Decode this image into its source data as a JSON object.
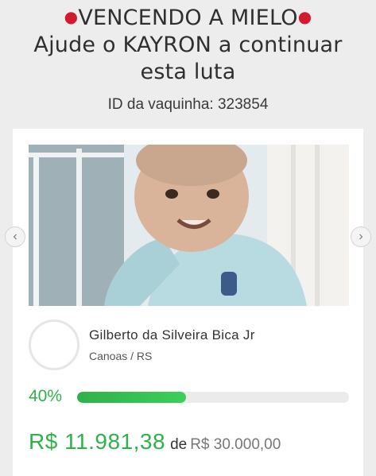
{
  "header": {
    "glove_icon": "boxing-glove-icon",
    "title_line1": "VENCENDO A MIELO",
    "title_line2": "Ajude o KAYRON a continuar",
    "title_line3": "esta luta",
    "campaign_id": "ID da vaquinha: 323854"
  },
  "gallery": {
    "prev_icon": "‹",
    "next_icon": "›"
  },
  "creator": {
    "name": "Gilberto da Silveira Bica Jr",
    "location": "Canoas / RS"
  },
  "progress": {
    "percent_label": "40%",
    "fraction": 0.4
  },
  "amounts": {
    "raised": "R$ 11.981,38",
    "connector": "de",
    "goal": "R$ 30.000,00"
  },
  "colors": {
    "accent_green": "#2fb14a",
    "glove_red": "#d11b2c",
    "background": "#ededed"
  }
}
